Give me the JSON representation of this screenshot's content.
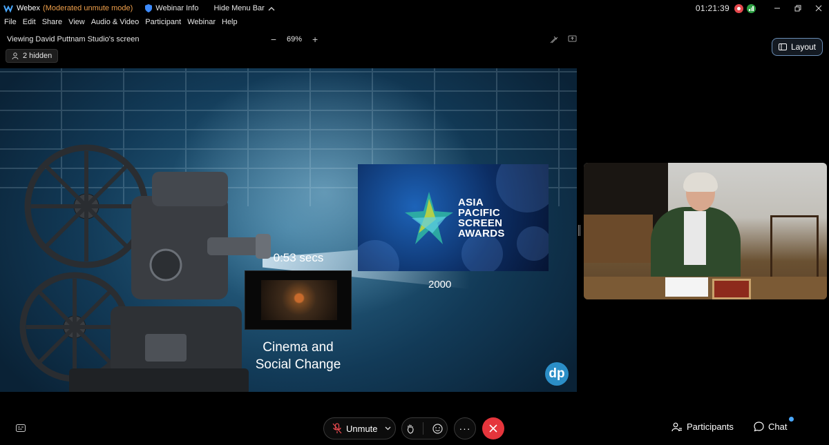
{
  "titlebar": {
    "app_name": "Webex",
    "mode": "(Moderated unmute mode)",
    "webinar_info": "Webinar Info",
    "hide_menu_bar": "Hide Menu Bar",
    "clock": "01:21:39"
  },
  "menu": {
    "file": "File",
    "edit": "Edit",
    "share": "Share",
    "view": "View",
    "audio_video": "Audio & Video",
    "participant": "Participant",
    "webinar": "Webinar",
    "help": "Help"
  },
  "share": {
    "viewing": "Viewing David Puttnam Studio's screen",
    "zoom": "69%",
    "hidden": "2 hidden",
    "layout_label": "Layout"
  },
  "slide": {
    "countdown": "0:53 secs",
    "caption_line1": "Cinema and",
    "caption_line2": "Social Change",
    "award_line1": "ASIA",
    "award_line2": "PACIFIC",
    "award_line3": "SCREEN",
    "award_line4": "AWARDS",
    "year": "2000",
    "logo_text": "dp"
  },
  "controls": {
    "unmute": "Unmute",
    "more": "···",
    "participants": "Participants",
    "chat": "Chat"
  },
  "colors": {
    "mode_orange": "#f0a04b",
    "end_red": "#e5353c",
    "layout_border": "#6b8fb8",
    "dp_blue": "#2b8ec7"
  },
  "icons": [
    "webex-logo-icon",
    "shield-icon",
    "chevron-up-icon",
    "record-icon",
    "signal-icon",
    "minimize-icon",
    "restore-icon",
    "close-icon",
    "person-icon",
    "layout-icon",
    "annotate-icon",
    "share-screen-icon",
    "captions-icon",
    "mic-muted-icon",
    "chevron-down-icon",
    "raise-hand-icon",
    "emoji-icon",
    "end-call-icon",
    "participants-icon",
    "chat-icon"
  ]
}
